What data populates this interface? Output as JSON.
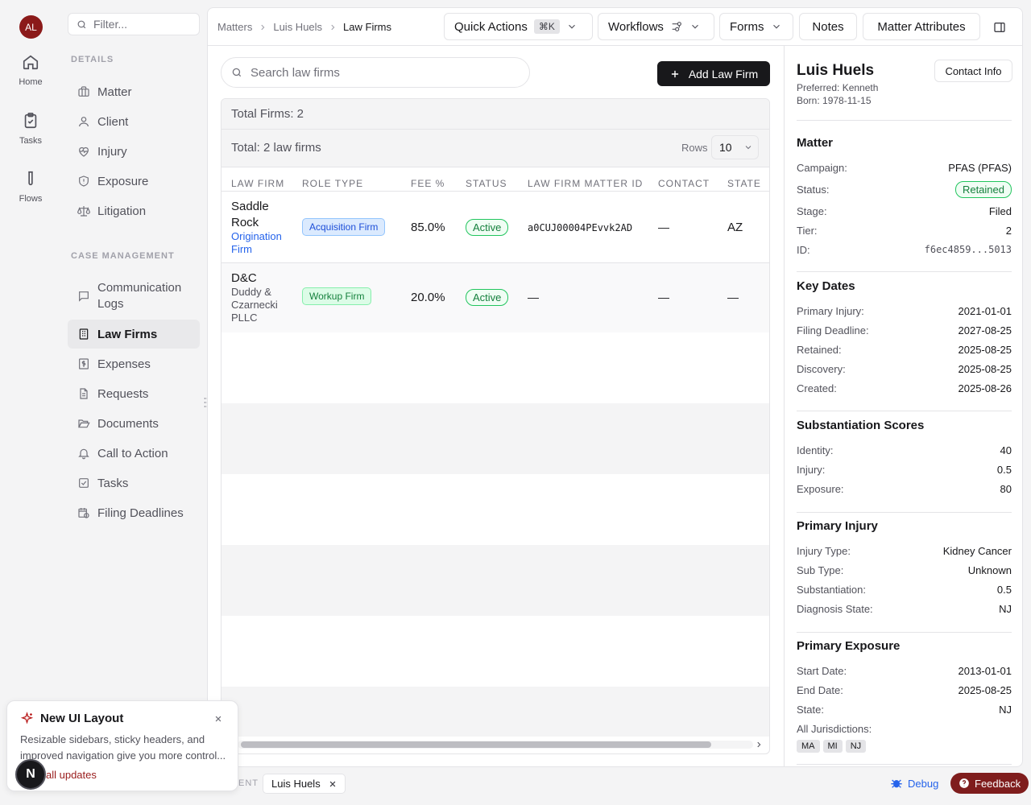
{
  "rail": {
    "avatar": "AL",
    "items": [
      {
        "label": "Home"
      },
      {
        "label": "Tasks"
      },
      {
        "label": "Flows"
      }
    ]
  },
  "nav": {
    "filter_placeholder": "Filter...",
    "details_label": "DETAILS",
    "details": [
      "Matter",
      "Client",
      "Injury",
      "Exposure",
      "Litigation"
    ],
    "case_label": "CASE MANAGEMENT",
    "case_items": [
      "Communication Logs",
      "Law Firms",
      "Expenses",
      "Requests",
      "Documents",
      "Call to Action",
      "Tasks",
      "Filing Deadlines"
    ]
  },
  "breadcrumb": [
    "Matters",
    "Luis Huels",
    "Law Firms"
  ],
  "toolbar": {
    "quick_actions": "Quick Actions",
    "quick_kbd": "⌘K",
    "workflows": "Workflows",
    "forms": "Forms",
    "notes": "Notes",
    "attributes": "Matter Attributes"
  },
  "search_placeholder": "Search law firms",
  "add_button": "Add Law Firm",
  "table": {
    "total_firms": "Total Firms: 2",
    "total_text": "Total: 2 law firms",
    "rows_label": "Rows",
    "rows_value": "10",
    "columns": [
      "LAW FIRM",
      "ROLE TYPE",
      "FEE %",
      "STATUS",
      "LAW FIRM MATTER ID",
      "CONTACT",
      "STATE"
    ],
    "rows": [
      {
        "firm": "Saddle Rock",
        "sub": "Origination Firm",
        "role": "Acquisition Firm",
        "fee": "85.0%",
        "status": "Active",
        "matter_id": "a0CUJ00004PEvvk2AD",
        "contact": "—",
        "state": "AZ"
      },
      {
        "firm": "D&C",
        "sub": "Duddy & Czarnecki PLLC",
        "role": "Workup Firm",
        "fee": "20.0%",
        "status": "Active",
        "matter_id": "—",
        "contact": "—",
        "state": "—"
      }
    ]
  },
  "profile": {
    "name": "Luis Huels",
    "preferred": "Preferred: Kenneth",
    "born": "Born: 1978-11-15",
    "contact_button": "Contact Info",
    "matter": {
      "title": "Matter",
      "campaign_k": "Campaign:",
      "campaign_v": "PFAS (PFAS)",
      "status_k": "Status:",
      "status_v": "Retained",
      "stage_k": "Stage:",
      "stage_v": "Filed",
      "tier_k": "Tier:",
      "tier_v": "2",
      "id_k": "ID:",
      "id_v": "f6ec4859...5013"
    },
    "dates": {
      "title": "Key Dates",
      "items": [
        [
          "Primary Injury:",
          "2021-01-01"
        ],
        [
          "Filing Deadline:",
          "2027-08-25"
        ],
        [
          "Retained:",
          "2025-08-25"
        ],
        [
          "Discovery:",
          "2025-08-25"
        ],
        [
          "Created:",
          "2025-08-26"
        ]
      ]
    },
    "scores": {
      "title": "Substantiation Scores",
      "items": [
        [
          "Identity:",
          "40"
        ],
        [
          "Injury:",
          "0.5"
        ],
        [
          "Exposure:",
          "80"
        ]
      ]
    },
    "injury": {
      "title": "Primary Injury",
      "items": [
        [
          "Injury Type:",
          "Kidney Cancer"
        ],
        [
          "Sub Type:",
          "Unknown"
        ],
        [
          "Substantiation:",
          "0.5"
        ],
        [
          "Diagnosis State:",
          "NJ"
        ]
      ]
    },
    "exposure": {
      "title": "Primary Exposure",
      "items": [
        [
          "Start Date:",
          "2013-01-01"
        ],
        [
          "End Date:",
          "2025-08-25"
        ],
        [
          "State:",
          "NJ"
        ]
      ],
      "jur_label": "All Jurisdictions:",
      "jurisdictions": [
        "MA",
        "MI",
        "NJ"
      ]
    }
  },
  "toast": {
    "title": "New UI Layout",
    "body": "Resizable sidebars, sticky headers, and improved navigation give you more control...",
    "link": "all updates"
  },
  "bottom": {
    "client_label": "ENT",
    "client_tab": "Luis Huels",
    "debug": "Debug",
    "feedback": "Feedback",
    "n": "N"
  }
}
